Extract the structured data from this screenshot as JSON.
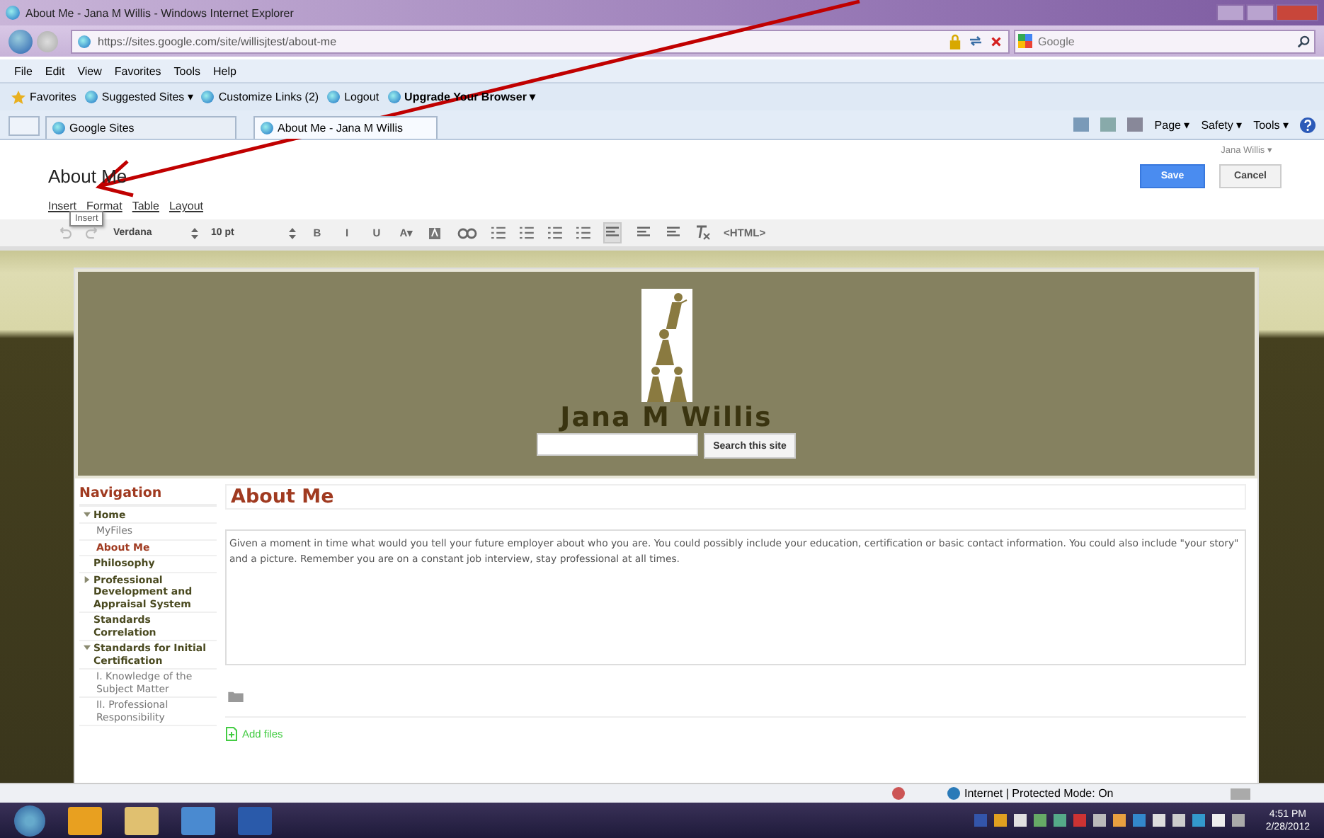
{
  "window": {
    "title": "About Me - Jana M Willis - Windows Internet Explorer"
  },
  "address_bar": {
    "url": "https://sites.google.com/site/willisjtest/about-me",
    "search_placeholder": "Google"
  },
  "menu_bar": [
    "File",
    "Edit",
    "View",
    "Favorites",
    "Tools",
    "Help"
  ],
  "favorites_bar": [
    {
      "label": "Favorites",
      "kind": "star"
    },
    {
      "label": "Suggested Sites ▾",
      "kind": "page"
    },
    {
      "label": "Customize Links (2)",
      "kind": "page"
    },
    {
      "label": "Logout",
      "kind": "page"
    },
    {
      "label": "Upgrade Your Browser ▾",
      "kind": "page"
    }
  ],
  "tabs": [
    {
      "label": "Google Sites",
      "selected": false
    },
    {
      "label": "About Me - Jana M Willis",
      "selected": true
    }
  ],
  "command_bar": [
    "Page ▾",
    "Safety ▾",
    "Tools ▾"
  ],
  "editor": {
    "user": "Jana Willis ▾",
    "page_title": "About Me",
    "save": "Save",
    "cancel": "Cancel",
    "menus": [
      "Insert",
      "Format",
      "Table",
      "Layout"
    ],
    "tooltip": "Insert",
    "toolbar": [
      {
        "kind": "undo"
      },
      {
        "kind": "redo"
      },
      {
        "kind": "select",
        "label": "Verdana"
      },
      {
        "kind": "select",
        "label": "10 pt"
      },
      {
        "kind": "text",
        "label": "B"
      },
      {
        "kind": "text",
        "label": "I"
      },
      {
        "kind": "text",
        "label": "U"
      },
      {
        "kind": "text",
        "label": "A▾"
      },
      {
        "kind": "highlight"
      },
      {
        "kind": "link"
      },
      {
        "kind": "numbered"
      },
      {
        "kind": "bullets"
      },
      {
        "kind": "outdent"
      },
      {
        "kind": "indent"
      },
      {
        "kind": "align",
        "selected": true
      },
      {
        "kind": "align",
        "selected": false
      },
      {
        "kind": "align",
        "selected": false
      },
      {
        "kind": "clear"
      },
      {
        "kind": "text",
        "label": "<HTML>"
      }
    ]
  },
  "site": {
    "name": "Jana M Willis",
    "search_button": "Search this site",
    "nav_title": "Navigation",
    "nav": [
      {
        "label": "Home",
        "expanded": true,
        "selected": false,
        "children": [
          {
            "label": "MyFiles",
            "selected": false
          },
          {
            "label": "About Me",
            "selected": true
          }
        ]
      },
      {
        "label": "Philosophy",
        "selected": false
      },
      {
        "label": "Professional Development and Appraisal System",
        "expanded": false,
        "selected": false
      },
      {
        "label": "Standards Correlation",
        "selected": false
      },
      {
        "label": "Standards for Initial Certification",
        "expanded": true,
        "selected": false,
        "children": [
          {
            "label": "I. Knowledge of the Subject Matter",
            "selected": false
          },
          {
            "label": "II. Professional Responsibility",
            "selected": false
          }
        ]
      }
    ],
    "heading": "About Me",
    "body": "Given a moment in time what would you tell your future employer about who you are. You could possibly include your education, certification or basic contact information. You could also include \"your story\" and a picture. Remember you are on a constant job interview, stay professional at all times.",
    "add_files": "Add files"
  },
  "status_bar": {
    "zone": "Internet | Protected Mode: On"
  },
  "taskbar": {
    "time": "4:51 PM",
    "date": "2/28/2012"
  }
}
